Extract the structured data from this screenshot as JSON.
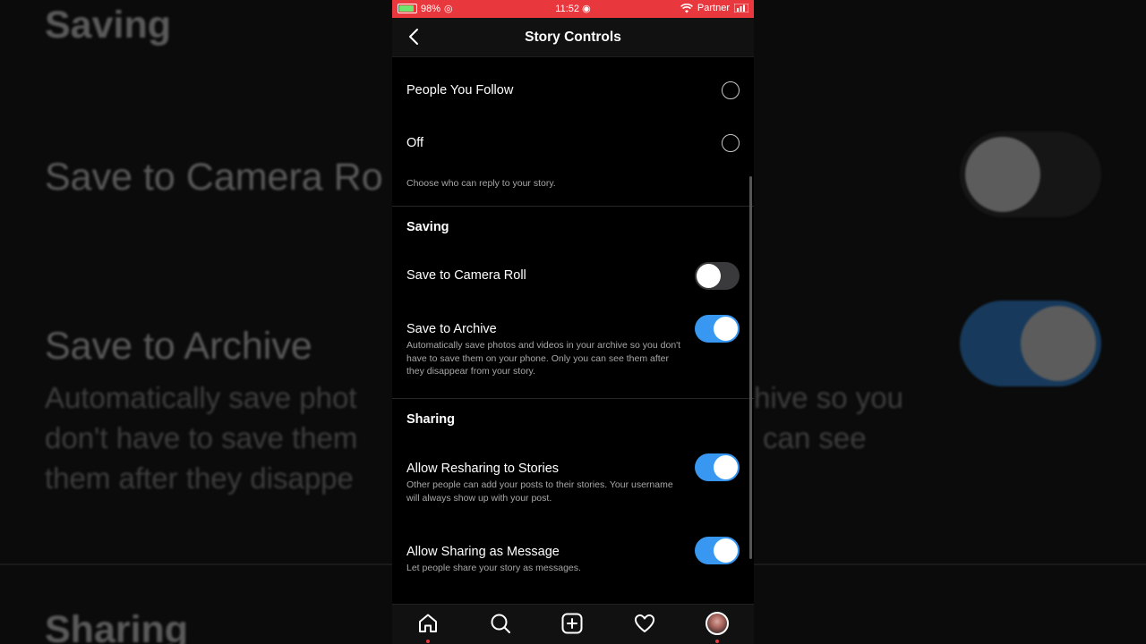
{
  "status_bar": {
    "battery": "98%",
    "time": "11:52",
    "carrier": "Partner"
  },
  "header": {
    "title": "Story Controls"
  },
  "reply_options": [
    {
      "label": "People You Follow",
      "selected": false
    },
    {
      "label": "Off",
      "selected": false
    }
  ],
  "reply_description": "Choose who can reply to your story.",
  "saving": {
    "title": "Saving",
    "camera_roll": {
      "label": "Save to Camera Roll",
      "enabled": false
    },
    "archive": {
      "label": "Save to Archive",
      "description": "Automatically save photos and videos in your archive so you don't have to save them on your phone. Only you can see them after they disappear from your story.",
      "enabled": true
    }
  },
  "sharing": {
    "title": "Sharing",
    "resharing": {
      "label": "Allow Resharing to Stories",
      "description": "Other people can add your posts to their stories. Your username will always show up with your post.",
      "enabled": true
    },
    "message": {
      "label": "Allow Sharing as Message",
      "description": "Let people share your story as messages.",
      "enabled": true
    }
  },
  "background": {
    "saving": "Saving",
    "camera_roll": "Save to Camera Ro",
    "archive": "Save to Archive",
    "desc_left_1": "Automatically save phot",
    "desc_left_2": "don't have to save them",
    "desc_left_3": "them after they disappe",
    "desc_right_1": "hive so you",
    "desc_right_2": "can see",
    "sharing": "Sharing"
  },
  "tabbar": {
    "icons": [
      "home-icon",
      "search-icon",
      "add-post-icon",
      "heart-icon",
      "profile-avatar"
    ]
  },
  "colors": {
    "status_bar": "#e8383d",
    "toggle_on": "#3897f0",
    "toggle_off": "#3a3a3c"
  }
}
